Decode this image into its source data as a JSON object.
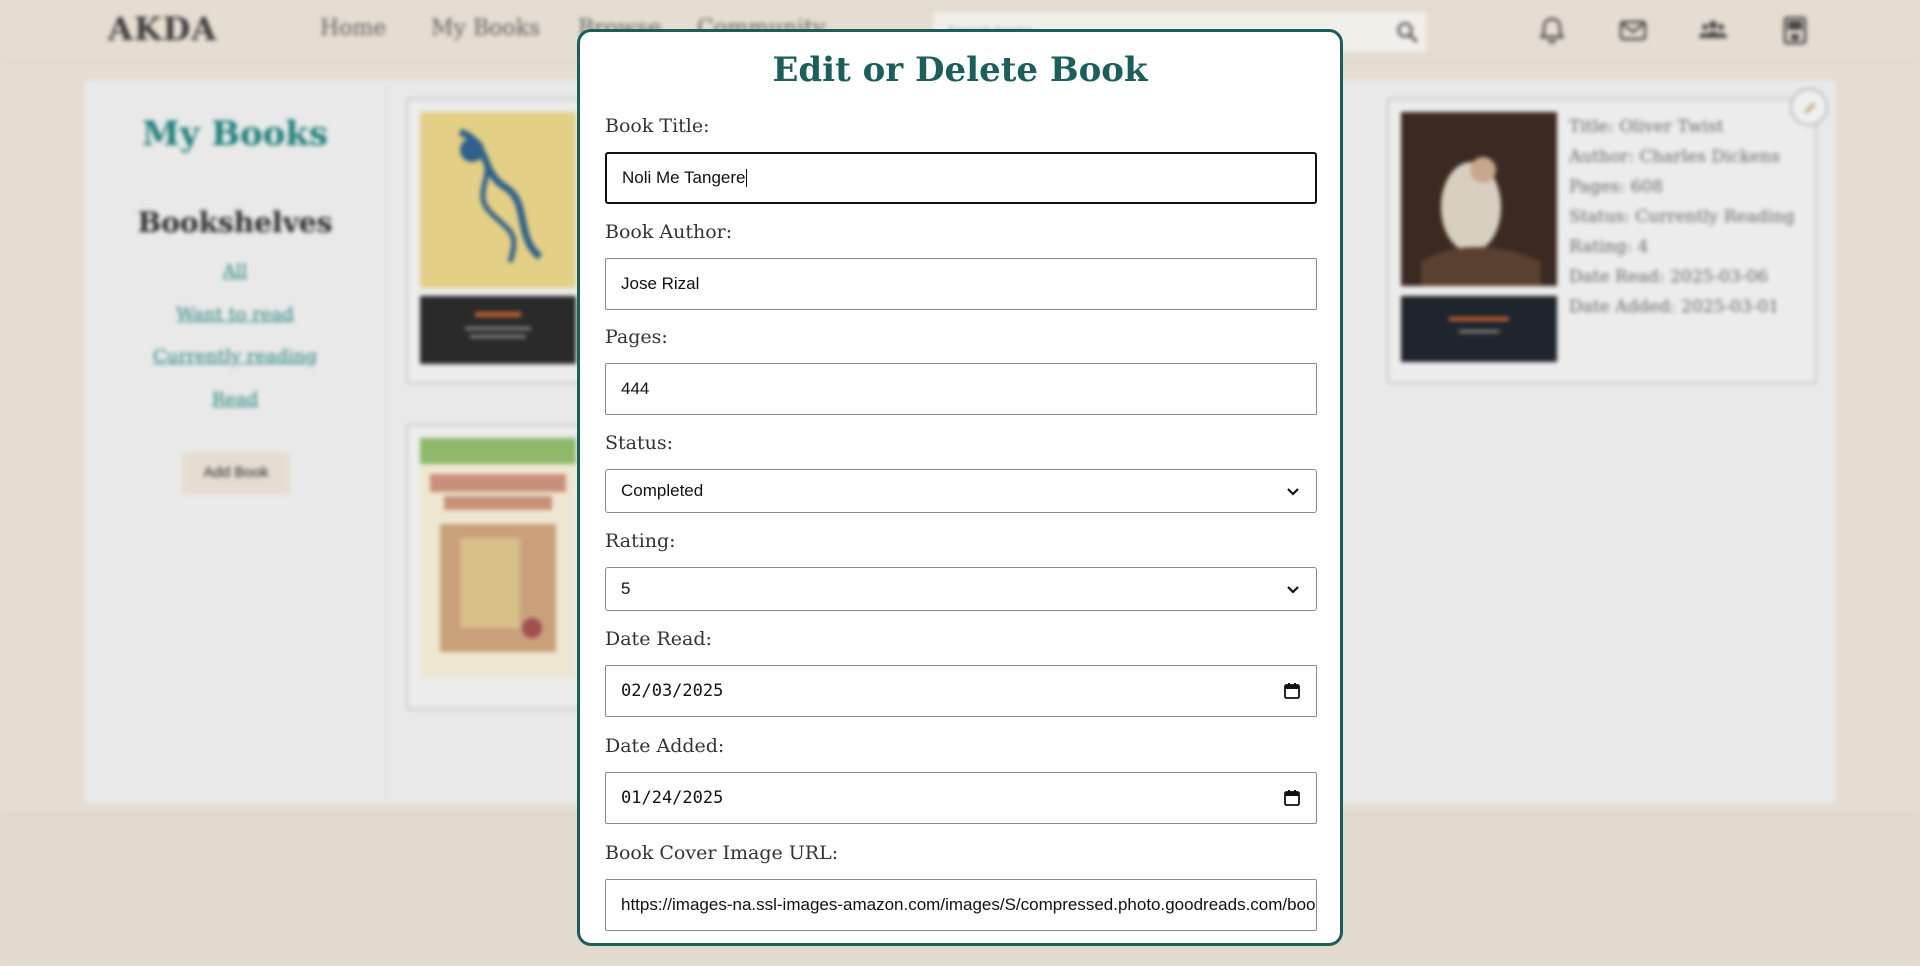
{
  "navbar": {
    "logo": "AKDA",
    "links": [
      "Home",
      "My Books",
      "Browse",
      "Community"
    ],
    "search_placeholder": "Search books",
    "icons": [
      "search-icon",
      "bell-icon",
      "mail-icon",
      "friends-icon",
      "profile-book-icon"
    ]
  },
  "sidebar": {
    "title": "My Books",
    "subtitle": "Bookshelves",
    "links": [
      "All",
      "Want to read",
      "Currently reading",
      "Read"
    ],
    "add_button": "Add Book"
  },
  "cards": [
    {
      "title_label": "Title: Oliver Twist",
      "author_label": "Author: Charles Dickens",
      "pages_label": "Pages: 608",
      "status_label": "Status: Currently Reading",
      "rating_label": "Rating: 4",
      "date_read_label": "Date Read: 2025-03-06",
      "date_added_label": "Date Added: 2025-03-01"
    }
  ],
  "modal": {
    "title": "Edit or Delete Book",
    "book_title_label": "Book Title:",
    "book_title_value": "Noli Me Tangere",
    "book_author_label": "Book Author:",
    "book_author_value": "Jose Rizal",
    "pages_label": "Pages:",
    "pages_value": "444",
    "status_label": "Status:",
    "status_value": "Completed",
    "rating_label": "Rating:",
    "rating_value": "5",
    "date_read_label": "Date Read:",
    "date_read_value": "02/03/2025",
    "date_added_label": "Date Added:",
    "date_added_value": "01/24/2025",
    "cover_url_label": "Book Cover Image URL:",
    "cover_url_value": "https://images-na.ssl-images-amazon.com/images/S/compressed.photo.goodreads.com/boo"
  },
  "colors": {
    "accent": "#1b5e5a",
    "background": "#e5ddd2"
  }
}
